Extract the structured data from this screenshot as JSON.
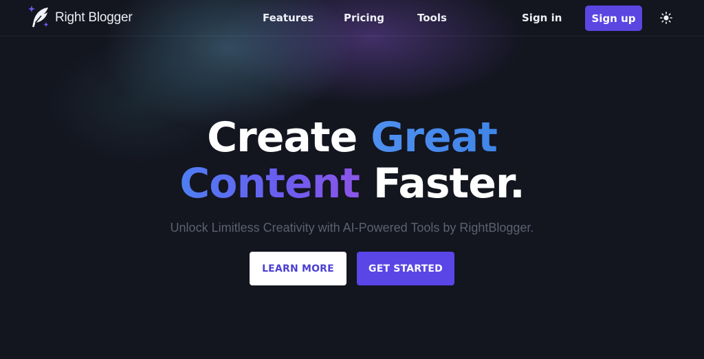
{
  "nav": {
    "brand": "Right Blogger",
    "brand_icon": "quill-sparkle-icon",
    "links": [
      {
        "label": "Features"
      },
      {
        "label": "Pricing"
      },
      {
        "label": "Tools"
      }
    ],
    "signin_label": "Sign in",
    "signup_label": "Sign up",
    "theme_icon": "sun-icon"
  },
  "hero": {
    "title_line1": {
      "part1": "Create ",
      "part2": "Great"
    },
    "title_line2": {
      "part1": "Content",
      "part2": " Faster."
    },
    "subtitle": "Unlock Limitless Creativity with AI-Powered Tools by RightBlogger.",
    "learn_more_label": "LEARN MORE",
    "get_started_label": "GET STARTED"
  },
  "colors": {
    "background": "#13151f",
    "accent": "#5a45e6",
    "gradient_blue": "#4f8ff0",
    "gradient_purple": "#8b55e8"
  }
}
